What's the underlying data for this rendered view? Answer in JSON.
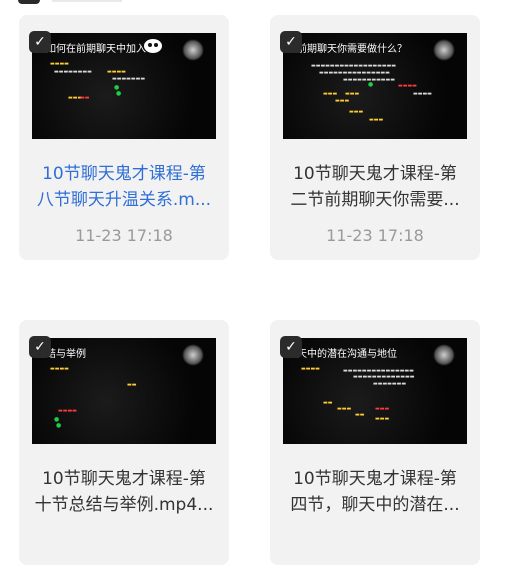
{
  "files": [
    {
      "name_line1": "10节聊天鬼才课程-第",
      "name_line2": "八节聊天升温关系.m...",
      "time": "11-23 17:18",
      "thumb_title": "如何在前期聊天中加入",
      "active": true
    },
    {
      "name_line1": "10节聊天鬼才课程-第",
      "name_line2": "二节前期聊天你需要...",
      "time": "11-23 17:18",
      "thumb_title": "前期聊天你需要做什么？",
      "active": false
    },
    {
      "name_line1": "10节聊天鬼才课程-第",
      "name_line2": "十节总结与举例.mp4...",
      "time": "",
      "thumb_title": "结与举例",
      "active": false
    },
    {
      "name_line1": "10节聊天鬼才课程-第",
      "name_line2": "四节，聊天中的潜在...",
      "time": "",
      "thumb_title": "天中的潜在沟通与地位",
      "active": false
    }
  ],
  "icons": {
    "checkbox": "checkbox-checked-icon"
  },
  "colors": {
    "active_text": "#2f6fd6",
    "card_bg": "#f2f2f3",
    "time_text": "#9a9a9a"
  }
}
